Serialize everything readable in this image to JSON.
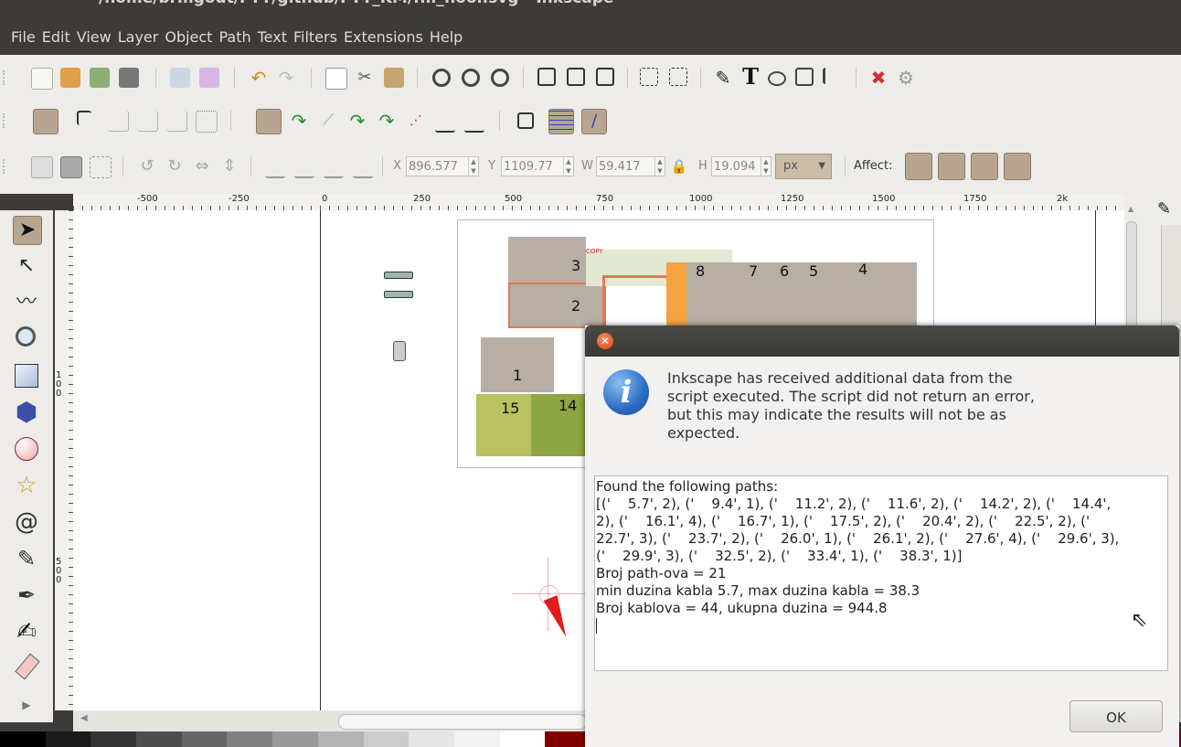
{
  "window": {
    "title": "/home/brmgout/FTT/github/FTT_KM/fm_floor.svg - Inkscape"
  },
  "menu": [
    "File",
    "Edit",
    "View",
    "Layer",
    "Object",
    "Path",
    "Text",
    "Filters",
    "Extensions",
    "Help"
  ],
  "toolbar_controls": {
    "x_label": "X",
    "x_value": "896.577",
    "y_label": "Y",
    "y_value": "1109.77",
    "w_label": "W",
    "w_value": "59.417",
    "h_label": "H",
    "h_value": "19.094",
    "unit": "px",
    "affect_label": "Affect:"
  },
  "ruler": {
    "h_labels": [
      "-500",
      "-250",
      "0",
      "250",
      "500",
      "750",
      "1000",
      "1250",
      "1500",
      "1750",
      "2k"
    ],
    "v_labels": [
      "100",
      "500"
    ]
  },
  "floorplan": {
    "rooms": [
      "3",
      "2",
      "1",
      "15",
      "14",
      "8",
      "7",
      "6",
      "5",
      "4"
    ],
    "annotations": [
      "COPY"
    ]
  },
  "dialog": {
    "message_lines": [
      "Inkscape has received additional data from the",
      "script executed.  The script did not return an error,",
      "but this may indicate the results will not be as",
      "expected."
    ],
    "output_lines": [
      "Found the following paths:",
      "[('    5.7', 2), ('    9.4', 1), ('    11.2', 2), ('    11.6', 2), ('    14.2', 2), ('    14.4',",
      "2), ('    16.1', 4), ('    16.7', 1), ('    17.5', 2), ('    20.4', 2), ('    22.5', 2), ('",
      "22.7', 3), ('    23.7', 2), ('    26.0', 1), ('    26.1', 2), ('    27.6', 4), ('    29.6', 3),",
      "('    29.9', 3), ('    32.5', 2), ('    33.4', 1), ('    38.3', 1)]",
      "Broj path-ova = 21",
      "min duzina kabla 5.7, max duzina kabla = 38.3",
      "Broj kablova = 44, ukupna duzina = 944.8"
    ],
    "ok_label": "OK"
  },
  "palette": [
    "#000000",
    "#1a1a1a",
    "#333333",
    "#4d4d4d",
    "#666666",
    "#808080",
    "#999999",
    "#b3b3b3",
    "#cccccc",
    "#e6e6e6",
    "#f2f2f2",
    "#ffffff",
    "#800000",
    "#ff0000",
    "#808000",
    "#ffff00",
    "#008000",
    "#00ff00",
    "#008080",
    "#00ffff",
    "#000080",
    "#0000ff",
    "#800080",
    "#ff00ff",
    "#400000",
    "#800040"
  ]
}
